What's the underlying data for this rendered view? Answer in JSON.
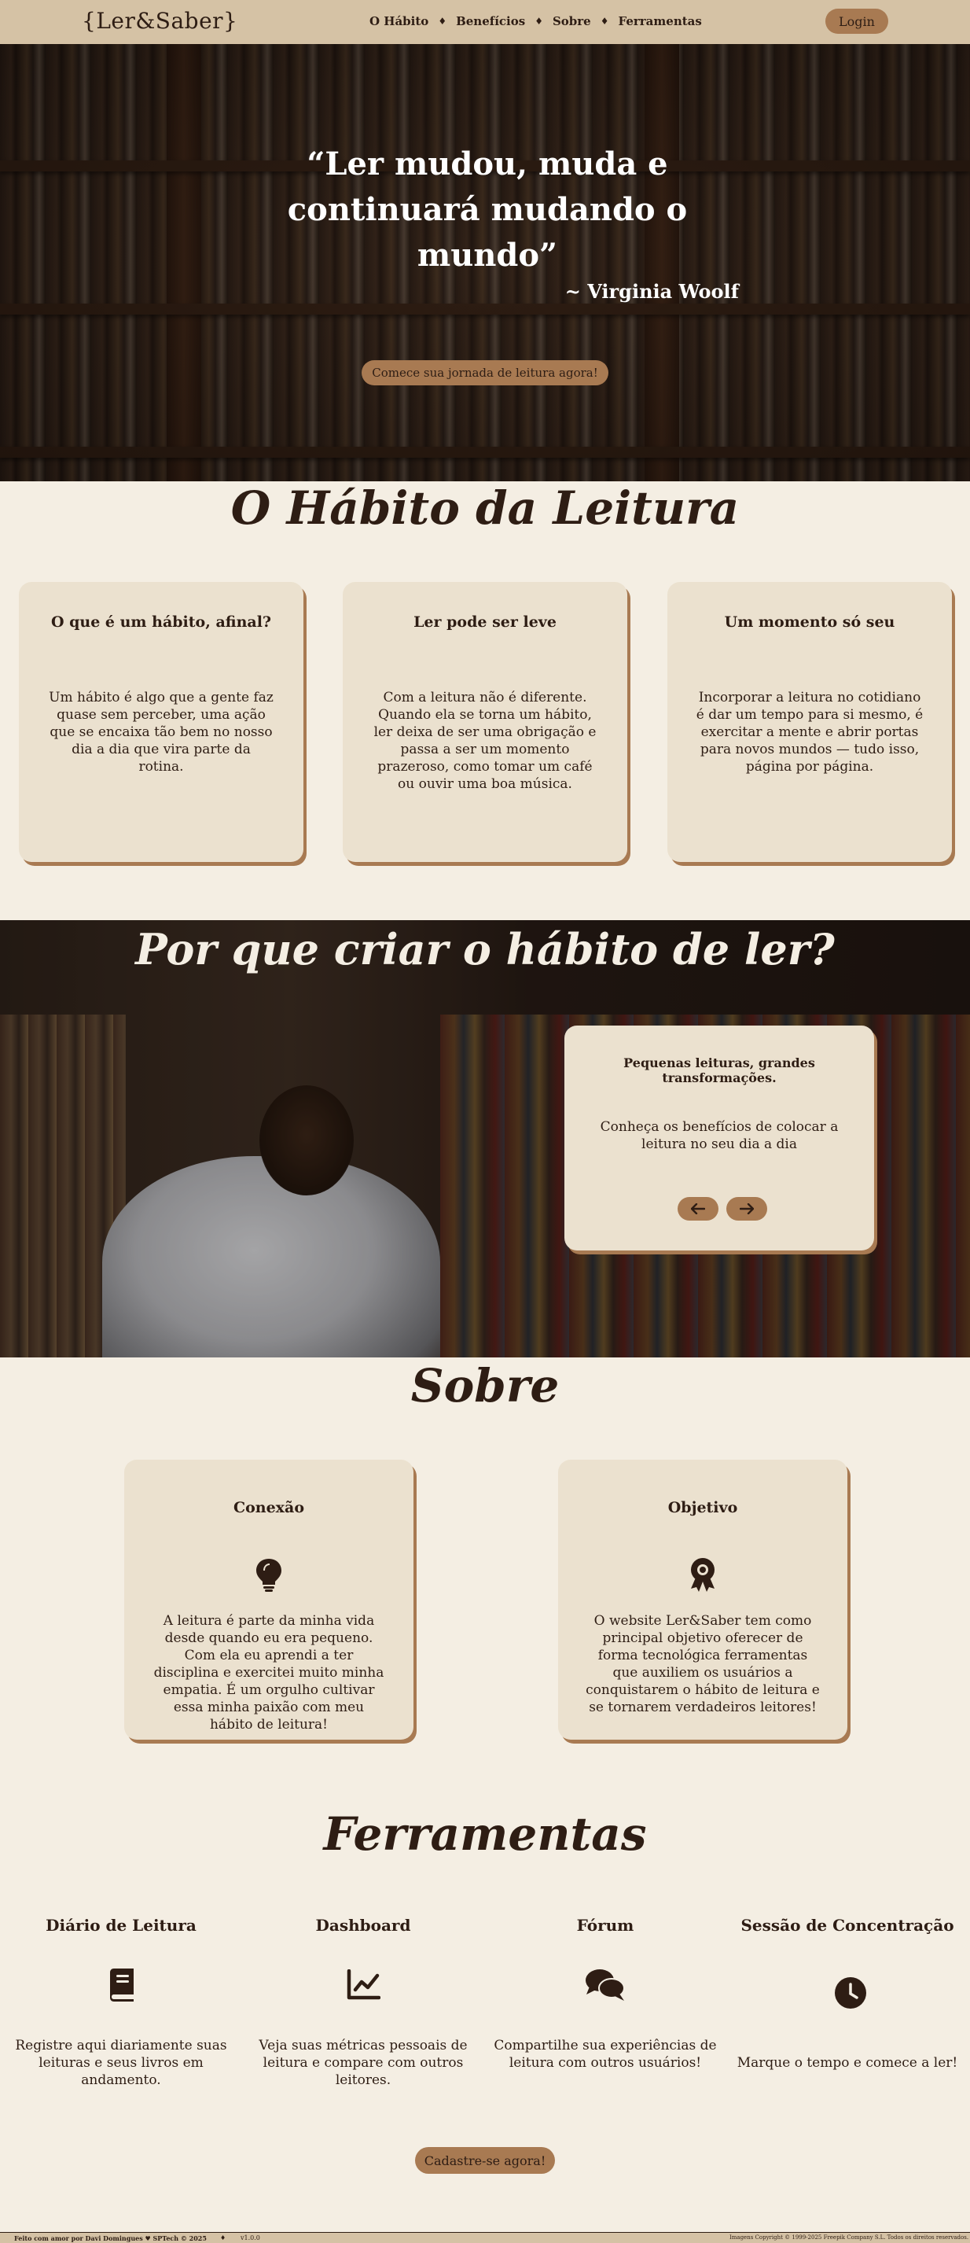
{
  "nav": {
    "logo": "{Ler&Saber}",
    "links": [
      "O Hábito",
      "Benefícios",
      "Sobre",
      "Ferramentas"
    ],
    "separator": "♦",
    "login_label": "Login"
  },
  "hero": {
    "quote": "“Ler mudou, muda e continuará mudando o mundo”",
    "author": "~ Virginia Woolf",
    "cta_label": "Comece sua jornada de leitura agora!"
  },
  "habit": {
    "title": "O Hábito da Leitura",
    "cards": [
      {
        "title": "O que é um hábito, afinal?",
        "text": "Um hábito é algo que a gente faz quase sem perceber, uma ação que se encaixa tão bem no nosso dia a dia que vira parte da rotina."
      },
      {
        "title": "Ler pode ser leve",
        "text": "Com a leitura não é diferente. Quando ela se torna um hábito, ler deixa de ser uma obrigação e passa a ser um momento prazeroso, como tomar um café ou ouvir uma boa música."
      },
      {
        "title": "Um momento só seu",
        "text": "Incorporar a leitura no cotidiano é dar um tempo para si mesmo, é exercitar a mente e abrir portas para novos mundos — tudo isso, página por página."
      }
    ]
  },
  "why": {
    "title": "Por que criar o hábito de ler?",
    "card_title": "Pequenas leituras, grandes transformações.",
    "card_text": "Conheça os benefícios de colocar a leitura no seu dia a dia",
    "prev_icon": "arrow-left-icon",
    "next_icon": "arrow-right-icon"
  },
  "about": {
    "title": "Sobre",
    "cards": [
      {
        "title": "Conexão",
        "icon": "lightbulb-icon",
        "text": "A leitura é parte da minha vida desde quando eu era pequeno. Com ela eu aprendi a ter disciplina e exercitei muito minha empatia. É um orgulho cultivar essa minha paixão com meu hábito de leitura!"
      },
      {
        "title": "Objetivo",
        "icon": "award-icon",
        "text": "O website Ler&Saber tem como principal objetivo oferecer de forma tecnológica ferramentas que auxiliem os usuários a conquistarem o hábito de leitura e se tornarem verdadeiros leitores!"
      }
    ]
  },
  "tools": {
    "title": "Ferramentas",
    "items": [
      {
        "title": "Diário de Leitura",
        "icon": "book-icon",
        "text": "Registre aqui diariamente suas leituras e seus livros em andamento."
      },
      {
        "title": "Dashboard",
        "icon": "chart-line-icon",
        "text": "Veja suas métricas pessoais de leitura e compare com outros leitores."
      },
      {
        "title": "Fórum",
        "icon": "comments-icon",
        "text": "Compartilhe sua experiências de leitura com outros usuários!"
      },
      {
        "title": "Sessão de Concentração",
        "icon": "clock-icon",
        "text": "Marque o tempo e comece a ler!"
      }
    ],
    "signup_label": "Cadastre-se agora!"
  },
  "footer": {
    "credit": "Feito com amor por Davi Domingues ♥ SPTech © 2025",
    "separator": "♦",
    "version": "v1.0.0",
    "image_credit": "Imagens Copyright © 1999-2025 Freepik Company S.L. Todos os direitos reservados."
  },
  "colors": {
    "background": "#f4eee3",
    "nav": "#d5c2a5",
    "card": "#ebe1cf",
    "accent": "#a87a52",
    "text": "#2e1d14"
  }
}
